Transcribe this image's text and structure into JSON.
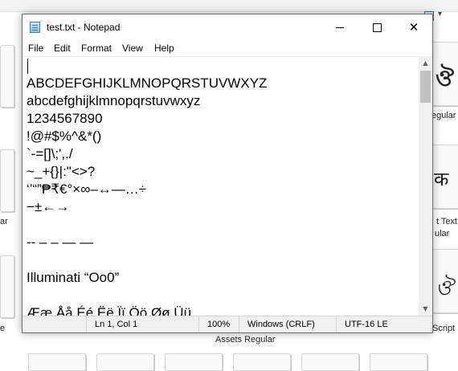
{
  "background_folder": {
    "left_labels": [
      "ar",
      "e"
    ],
    "right_labels": [
      "egular",
      "t Text",
      "ular",
      "Script"
    ],
    "bottom_label": "Assets Regular",
    "glyphs": [
      "ঔ",
      "क",
      "ঔ"
    ]
  },
  "window": {
    "title": "test.txt - Notepad",
    "menu": [
      "File",
      "Edit",
      "Format",
      "View",
      "Help"
    ],
    "lines": [
      "ABCDEFGHIJKLMNOPQRSTUVWXYZ",
      "abcdefghijklmnopqrstuvwxyz",
      "1234567890",
      "!@#$%^&*()",
      "`-=[]\\;',./",
      "~_+{}|:\"<>?",
      "‘’“”₱₹€°×∞–↔—…÷",
      "−±←→",
      "",
      "-- – – — —",
      "",
      "Illuminati “Oo0”",
      "",
      "Ææ Åå Éé Ëë Ïï Öö Øø Üü"
    ],
    "status": {
      "position": "Ln 1, Col 1",
      "zoom": "100%",
      "line_ending": "Windows (CRLF)",
      "encoding": "UTF-16 LE"
    }
  }
}
